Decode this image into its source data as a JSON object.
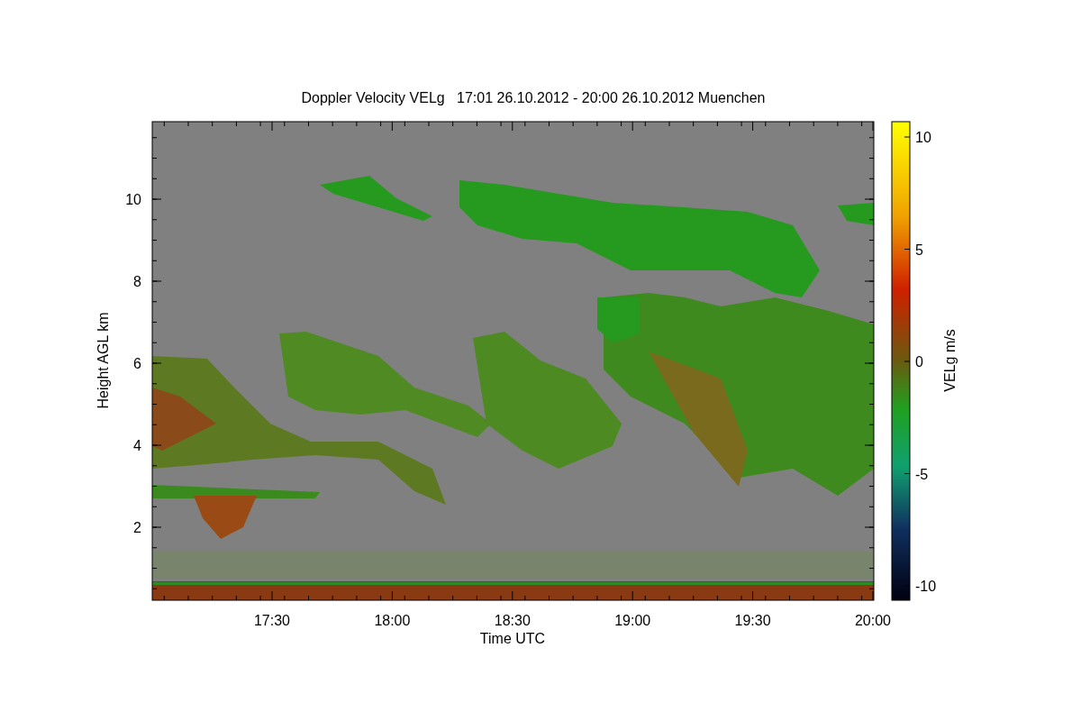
{
  "title": "Doppler Velocity VELg   17:01 26.10.2012 - 20:00 26.10.2012 Muenchen",
  "plot": {
    "xlabel": "Time UTC",
    "ylabel": "Height AGL km",
    "xticks": [
      "17:30",
      "18:00",
      "18:30",
      "19:00",
      "19:30",
      "20:00"
    ],
    "yticks": [
      "10",
      "8",
      "6",
      "4",
      "2"
    ]
  },
  "colorbar": {
    "label": "VELg m/s",
    "ticks": [
      "10",
      "5",
      "0",
      "-5",
      "-10"
    ]
  }
}
